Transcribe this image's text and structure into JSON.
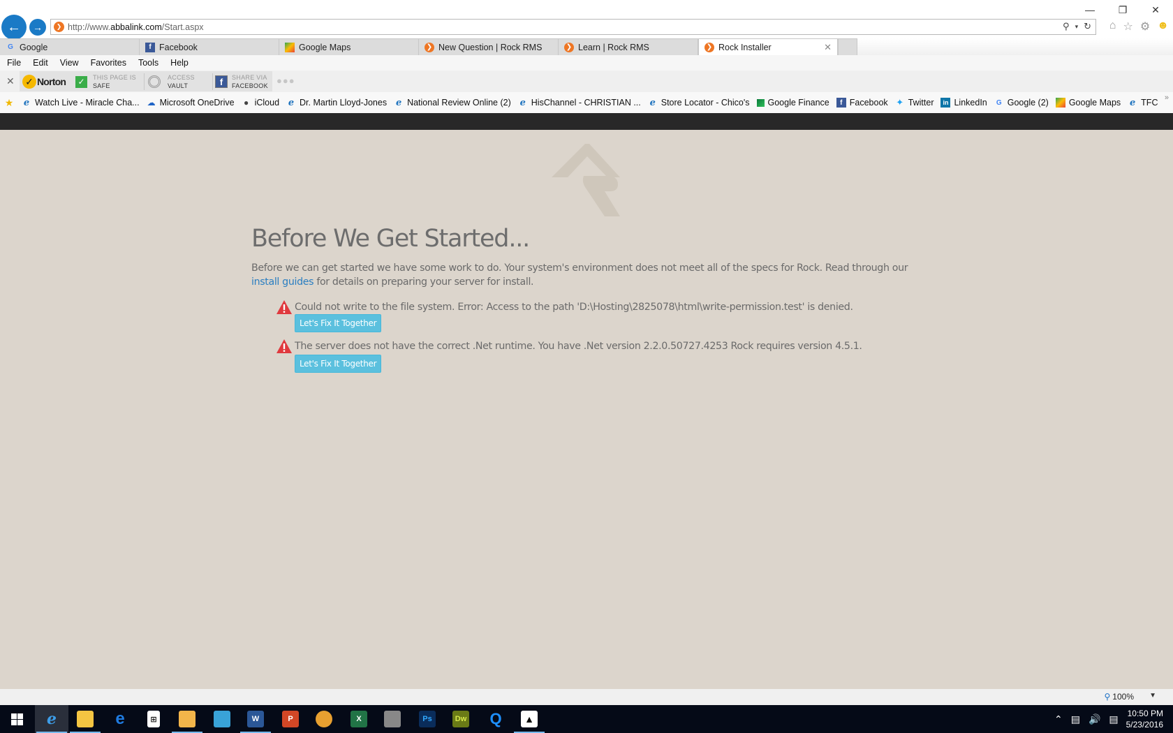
{
  "window": {
    "minimize_icon": "minimize-icon",
    "restore_icon": "restore-icon",
    "close_icon": "close-icon"
  },
  "nav": {
    "back_icon": "back-arrow-icon",
    "forward_icon": "forward-arrow-icon",
    "url_prefix": "http://www.",
    "url_domain": "abbalink.com",
    "url_path": "/Start.aspx",
    "search_icon": "search-icon",
    "refresh_icon": "refresh-icon",
    "tools": [
      "home-icon",
      "favorites-star-icon",
      "settings-gear-icon",
      "feedback-smiley-icon"
    ]
  },
  "tabs": [
    {
      "label": "Google",
      "icon": "google-icon",
      "active": false
    },
    {
      "label": "Facebook",
      "icon": "facebook-icon",
      "active": false
    },
    {
      "label": "Google Maps",
      "icon": "google-maps-icon",
      "active": false
    },
    {
      "label": "New Question | Rock RMS",
      "icon": "rock-rms-icon",
      "active": false
    },
    {
      "label": "Learn | Rock RMS",
      "icon": "rock-rms-icon",
      "active": false
    },
    {
      "label": "Rock Installer",
      "icon": "rock-rms-icon",
      "active": true
    }
  ],
  "menu": [
    "File",
    "Edit",
    "View",
    "Favorites",
    "Tools",
    "Help"
  ],
  "norton": {
    "brand": "Norton",
    "safe_top": "THIS PAGE IS",
    "safe_bottom": "SAFE",
    "vault_top": "ACCESS",
    "vault_bottom": "VAULT",
    "share_top": "SHARE VIA",
    "share_bottom": "FACEBOOK"
  },
  "favorites": [
    {
      "label": "Watch Live - Miracle Cha...",
      "icon": "ie-page-icon"
    },
    {
      "label": "Microsoft OneDrive",
      "icon": "onedrive-icon"
    },
    {
      "label": "iCloud",
      "icon": "apple-icon"
    },
    {
      "label": "Dr. Martin Lloyd-Jones",
      "icon": "ie-page-icon"
    },
    {
      "label": "National Review Online (2)",
      "icon": "ie-page-icon"
    },
    {
      "label": "HisChannel - CHRISTIAN ...",
      "icon": "ie-page-icon"
    },
    {
      "label": "Store Locator - Chico's",
      "icon": "ie-page-icon"
    },
    {
      "label": "Google Finance",
      "icon": "google-finance-icon"
    },
    {
      "label": "Facebook",
      "icon": "facebook-icon"
    },
    {
      "label": "Twitter",
      "icon": "twitter-icon"
    },
    {
      "label": "LinkedIn",
      "icon": "linkedin-icon"
    },
    {
      "label": "Google (2)",
      "icon": "google-icon"
    },
    {
      "label": "Google Maps",
      "icon": "google-maps-icon"
    },
    {
      "label": "TFC",
      "icon": "ie-page-icon"
    }
  ],
  "page": {
    "title": "Before We Get Started...",
    "intro_before_link": "Before we can get started we have some work to do. Your system's environment does not meet all of the specs for Rock. Read through our ",
    "intro_link": "install guides",
    "intro_after_link": " for details on preparing your server for install.",
    "errors": [
      {
        "message": "Could not write to the file system. Error: Access to the path 'D:\\Hosting\\2825078\\html\\write-permission.test' is denied.",
        "button": "Let's Fix It Together"
      },
      {
        "message": "The server does not have the correct .Net runtime. You have .Net version 2.2.0.50727.4253 Rock requires version 4.5.1.",
        "button": "Let's Fix It Together"
      }
    ],
    "colors": {
      "background": "#dcd5cc",
      "header": "#282828",
      "link": "#2a7ec1",
      "button": "#5bc0de",
      "warning": "#e0393e"
    }
  },
  "status": {
    "zoom": "100%"
  },
  "taskbar": {
    "apps": [
      "start-windows-icon",
      "internet-explorer-icon",
      "file-explorer-icon",
      "edge-icon",
      "store-icon",
      "outlook-icon",
      "app-icon",
      "word-icon",
      "powerpoint-icon",
      "app-icon-2",
      "excel-icon",
      "app-icon-3",
      "photoshop-icon",
      "dreamweaver-icon",
      "quicktime-icon",
      "photos-icon"
    ],
    "time": "10:50 PM",
    "date": "5/23/2016"
  }
}
